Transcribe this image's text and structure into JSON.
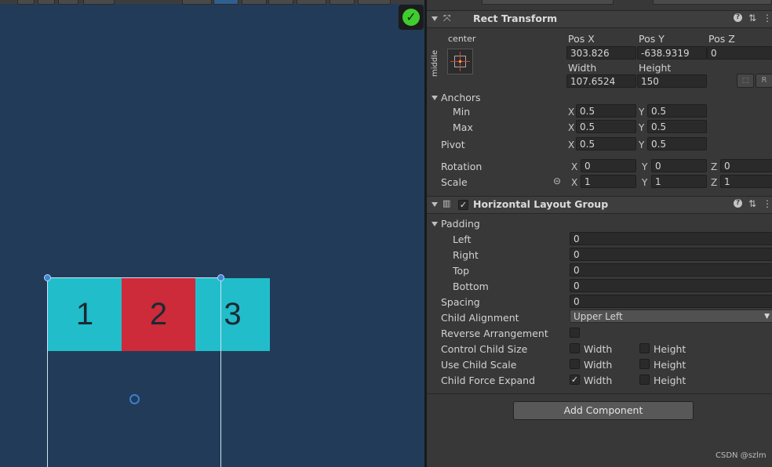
{
  "colors": {
    "scene_bg": "#223b58",
    "cell_cyan": "#22bdca",
    "cell_red": "#cd2a3a",
    "check_green": "#3fcc2f"
  },
  "scene": {
    "cells": [
      "1",
      "2",
      "3"
    ]
  },
  "rect_transform": {
    "title": "Rect Transform",
    "anchor_preset": {
      "horizontal": "center",
      "vertical": "middle"
    },
    "pos_x_label": "Pos X",
    "pos_y_label": "Pos Y",
    "pos_z_label": "Pos Z",
    "pos_x": "303.826",
    "pos_y": "-638.9319",
    "pos_z": "0",
    "width_label": "Width",
    "height_label": "Height",
    "width": "107.6524",
    "height": "150",
    "raw_button": "R",
    "anchors_label": "Anchors",
    "min_label": "Min",
    "max_label": "Max",
    "pivot_label": "Pivot",
    "x_axis": "X",
    "y_axis": "Y",
    "z_axis": "Z",
    "min_x": "0.5",
    "min_y": "0.5",
    "max_x": "0.5",
    "max_y": "0.5",
    "pivot_x": "0.5",
    "pivot_y": "0.5",
    "rotation_label": "Rotation",
    "rot_x": "0",
    "rot_y": "0",
    "rot_z": "0",
    "scale_label": "Scale",
    "scale_x": "1",
    "scale_y": "1",
    "scale_z": "1"
  },
  "layout_group": {
    "title": "Horizontal Layout Group",
    "padding_label": "Padding",
    "left_label": "Left",
    "right_label": "Right",
    "top_label": "Top",
    "bottom_label": "Bottom",
    "left": "0",
    "right": "0",
    "top": "0",
    "bottom": "0",
    "spacing_label": "Spacing",
    "spacing": "0",
    "child_alignment_label": "Child Alignment",
    "child_alignment": "Upper Left",
    "reverse_label": "Reverse Arrangement",
    "control_size_label": "Control Child Size",
    "use_scale_label": "Use Child Scale",
    "force_expand_label": "Child Force Expand",
    "width_opt": "Width",
    "height_opt": "Height",
    "checked_mark": "✓"
  },
  "add_component": "Add Component",
  "watermark": "CSDN @szlm",
  "icons": {
    "help": "?",
    "settings": "⇅",
    "menu": "⋮",
    "link": "⊝"
  }
}
